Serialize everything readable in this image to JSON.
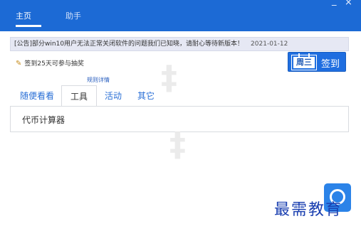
{
  "titlebar": {
    "tabs": [
      {
        "label": "主页"
      },
      {
        "label": "助手"
      }
    ],
    "minimize": "_",
    "close": "×"
  },
  "notice": {
    "text": "[公告]部分win10用户无法正常关闭软件的问题我们已知晓，请耐心等待新版本！",
    "date": "2021-01-12"
  },
  "lottery": {
    "text": "签到25天可参与抽奖"
  },
  "signin": {
    "weekday": "周三",
    "label": "签到"
  },
  "rules_link": "规则详情",
  "subtabs": [
    {
      "label": "随便看看"
    },
    {
      "label": "工具"
    },
    {
      "label": "活动"
    },
    {
      "label": "其它"
    }
  ],
  "panel": {
    "item": "代币计算器"
  },
  "watermark": {
    "brand": "最需教育"
  }
}
